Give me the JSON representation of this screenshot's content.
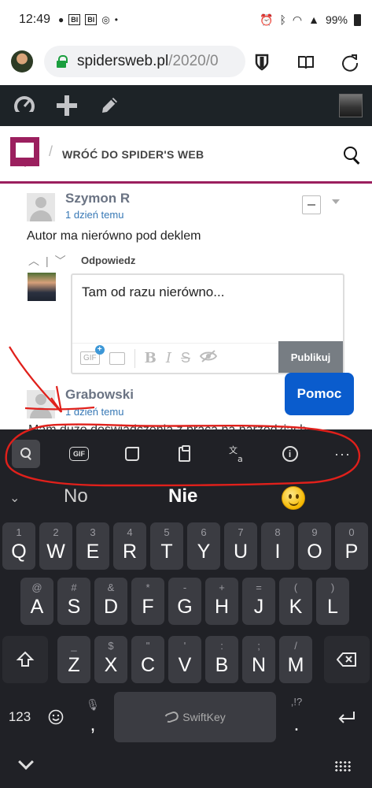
{
  "status_bar": {
    "time": "12:49",
    "app_badges": [
      "BI",
      "BI"
    ],
    "battery": "99%"
  },
  "browser": {
    "url_host": "spidersweb.pl",
    "url_path": "/2020/0",
    "icons": [
      "shield-icon",
      "reader-mode-icon",
      "reload-icon"
    ]
  },
  "admin_bar": {
    "icons": [
      "dashboard-icon",
      "plus-icon",
      "edit-pencil-icon"
    ]
  },
  "site_header": {
    "back_link": "WRÓĆ DO SPIDER'S WEB",
    "brand_color": "#9b1f5e"
  },
  "comments": [
    {
      "author": "Szymon R",
      "date": "1 dzień temu",
      "text": "Autor ma nierówno pod deklem"
    },
    {
      "author": "Grabowski",
      "date": "1 dzień temu",
      "text": "Mam dużo doświadczenia z pracą na narzędziach"
    }
  ],
  "reply": {
    "label": "Odpowiedz",
    "text": "Tam od razu nierówno...",
    "publish_label": "Publikuj",
    "toolbar_gif": "GIF",
    "toolbar_icons": [
      "gif-icon",
      "image-icon",
      "bold-icon",
      "italic-icon",
      "strikethrough-icon",
      "spoiler-icon"
    ]
  },
  "help_button": "Pomoc",
  "keyboard": {
    "toolbar_gif": "GIF",
    "toolbar_icons": [
      "search-icon",
      "gif-icon",
      "sticker-icon",
      "clipboard-icon",
      "translate-icon",
      "info-icon",
      "more-icon"
    ],
    "suggestions": [
      "No",
      "Nie"
    ],
    "suggestion_emoji": "smiley-emoji",
    "rows": [
      [
        {
          "m": "Q",
          "s": "1"
        },
        {
          "m": "W",
          "s": "2"
        },
        {
          "m": "E",
          "s": "3"
        },
        {
          "m": "R",
          "s": "4"
        },
        {
          "m": "T",
          "s": "5"
        },
        {
          "m": "Y",
          "s": "6"
        },
        {
          "m": "U",
          "s": "7"
        },
        {
          "m": "I",
          "s": "8"
        },
        {
          "m": "O",
          "s": "9"
        },
        {
          "m": "P",
          "s": "0"
        }
      ],
      [
        {
          "m": "A",
          "s": "@"
        },
        {
          "m": "S",
          "s": "#"
        },
        {
          "m": "D",
          "s": "&"
        },
        {
          "m": "F",
          "s": "*"
        },
        {
          "m": "G",
          "s": "-"
        },
        {
          "m": "H",
          "s": "+"
        },
        {
          "m": "J",
          "s": "="
        },
        {
          "m": "K",
          "s": "("
        },
        {
          "m": "L",
          "s": ")"
        }
      ],
      [
        {
          "m": "Z",
          "s": "_"
        },
        {
          "m": "X",
          "s": "$"
        },
        {
          "m": "C",
          "s": "\""
        },
        {
          "m": "V",
          "s": "'"
        },
        {
          "m": "B",
          "s": ":"
        },
        {
          "m": "N",
          "s": ";"
        },
        {
          "m": "M",
          "s": "/"
        }
      ]
    ],
    "numbers_label": "123",
    "comma_label": ",",
    "period_label": ".",
    "period_alt": ",!?",
    "space_brand": "SwiftKey"
  },
  "annotation_color": "#e0201b"
}
